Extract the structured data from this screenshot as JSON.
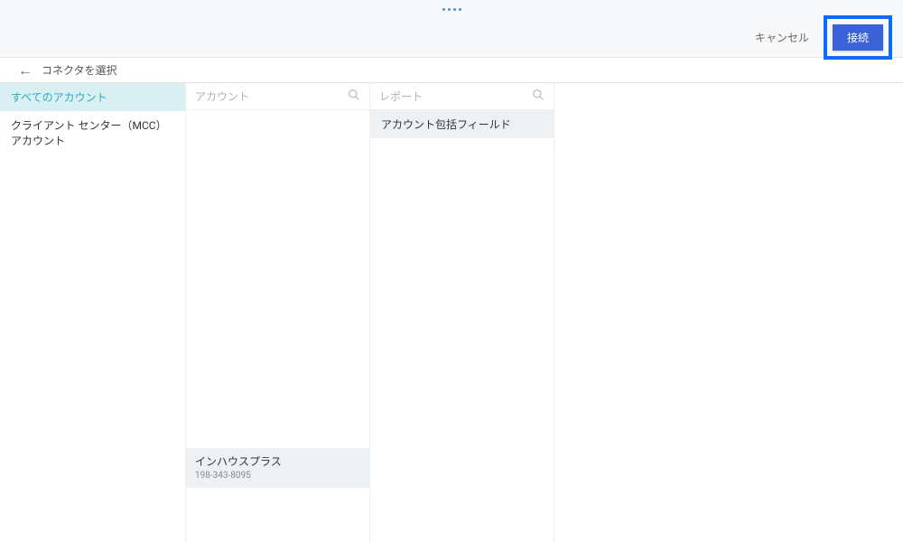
{
  "topbar": {
    "cancel_label": "キャンセル",
    "connect_label": "接続"
  },
  "breadcrumb": {
    "label": "コネクタを選択"
  },
  "col1": {
    "items": [
      {
        "label": "すべてのアカウント",
        "selected": true
      },
      {
        "label": "クライアント センター（MCC）アカウント",
        "selected": false
      }
    ]
  },
  "col2": {
    "search_placeholder": "アカウント",
    "selected_account": {
      "name": "インハウスプラス",
      "id": "198-343-8095"
    }
  },
  "col3": {
    "search_placeholder": "レポート",
    "items": [
      {
        "label": "アカウント包括フィールド"
      }
    ]
  }
}
